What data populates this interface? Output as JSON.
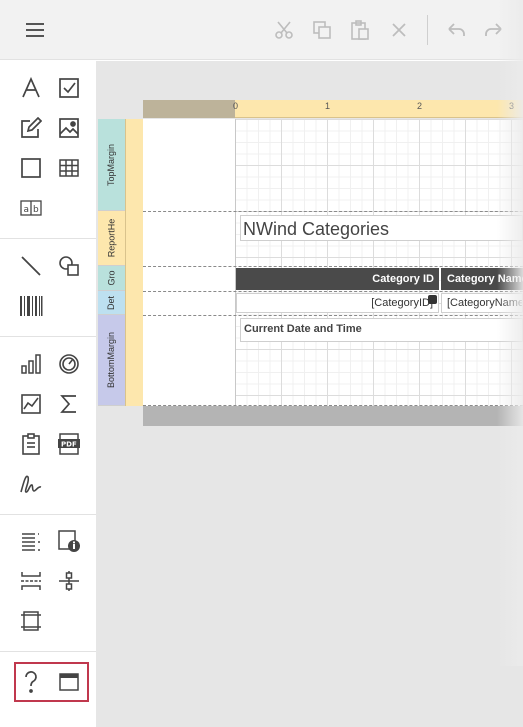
{
  "toolbar": {
    "menu_icon": "hamburger-icon",
    "cut_icon": "scissors-icon",
    "copy_icon": "copy-icon",
    "paste_icon": "paste-icon",
    "delete_icon": "close-icon",
    "undo_icon": "undo-icon",
    "redo_icon": "redo-icon"
  },
  "toolbox": {
    "items": [
      {
        "name": "label-tool",
        "icon": "text-A-icon"
      },
      {
        "name": "checkbox-tool",
        "icon": "checkbox-icon"
      },
      {
        "name": "rich-text-tool",
        "icon": "pencil-edit-icon"
      },
      {
        "name": "picture-box-tool",
        "icon": "image-icon"
      },
      {
        "name": "panel-tool",
        "icon": "square-icon"
      },
      {
        "name": "table-tool",
        "icon": "table-icon"
      },
      {
        "name": "character-comb-tool",
        "icon": "character-comb-icon"
      },
      {
        "name": "line-tool",
        "icon": "line-icon"
      },
      {
        "name": "shape-tool",
        "icon": "shape-icon"
      },
      {
        "name": "barcode-tool",
        "icon": "barcode-icon"
      },
      {
        "name": "chart-tool",
        "icon": "bar-chart-icon"
      },
      {
        "name": "gauge-tool",
        "icon": "gauge-icon"
      },
      {
        "name": "sparkline-tool",
        "icon": "sparkline-icon"
      },
      {
        "name": "summary-tool",
        "icon": "sigma-icon"
      },
      {
        "name": "page-info-tool",
        "icon": "clipboard-icon"
      },
      {
        "name": "pdf-content-tool",
        "icon": "pdf-icon"
      },
      {
        "name": "signature-tool",
        "icon": "signature-icon"
      },
      {
        "name": "table-of-contents-tool",
        "icon": "list-icon"
      },
      {
        "name": "subreport-tool",
        "icon": "subreport-icon"
      },
      {
        "name": "page-break-tool",
        "icon": "page-break-icon"
      },
      {
        "name": "cross-band-line-tool",
        "icon": "cross-band-line-icon"
      },
      {
        "name": "cross-band-box-tool",
        "icon": "cross-band-box-icon"
      },
      {
        "name": "help-tool",
        "icon": "question-icon"
      },
      {
        "name": "window-tool",
        "icon": "window-icon"
      }
    ],
    "pdf_text": "PDF"
  },
  "ruler": {
    "top_numbers": [
      "0",
      "1",
      "2",
      "3"
    ]
  },
  "bands": [
    {
      "id": "top-margin",
      "label": "TopMargin",
      "color": "#b9e1dc"
    },
    {
      "id": "report-header",
      "label": "ReportHe",
      "color": "#fde7ad"
    },
    {
      "id": "group-header",
      "label": "Gro",
      "color": "#b9e1dc"
    },
    {
      "id": "detail",
      "label": "Det",
      "color": "#bde0f0"
    },
    {
      "id": "bottom-margin",
      "label": "BottomMargin",
      "color": "#c6c9ea"
    }
  ],
  "report": {
    "title": "NWind Categories",
    "header_cells": [
      "Category ID",
      "Category Name"
    ],
    "detail_cells": [
      "[CategoryID]",
      "[CategoryName]"
    ],
    "footer_text": "Current Date and Time"
  },
  "colors": {
    "highlight": "#c0384d",
    "header_bg": "#4a4a4a",
    "ruler": "#fde7ad"
  }
}
